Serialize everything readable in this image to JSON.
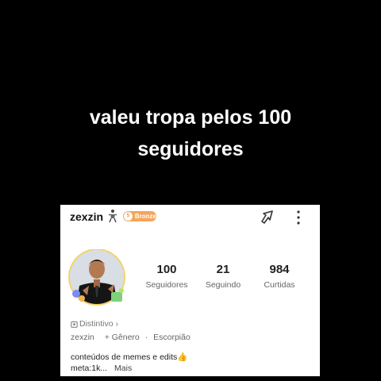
{
  "caption": {
    "line1": "valeu tropa pelos 100",
    "line2": "seguidores"
  },
  "profile": {
    "username": "zexzin",
    "level_number": "5",
    "level_label": "Bronze",
    "stats": [
      {
        "value": "100",
        "label": "Seguidores"
      },
      {
        "value": "21",
        "label": "Seguindo"
      },
      {
        "value": "984",
        "label": "Curtidas"
      }
    ],
    "distintivo": "Distintivo",
    "distintivo_chevron": "›",
    "handle": "zexzin",
    "gender": "+ Gênero",
    "separator": "·",
    "sign": "Escorpião",
    "bio_line1": "conteúdos de memes e edits👍",
    "bio_line2": "meta:1k...",
    "more_label": "Mais"
  },
  "icons": {
    "badge": "figure-badge-icon",
    "share": "share-arrow-icon",
    "more": "vertical-dots-icon",
    "distintivo": "badge-outline-icon"
  },
  "colors": {
    "background": "#000000",
    "card": "#ffffff",
    "level_badge": "#f5a55a"
  }
}
